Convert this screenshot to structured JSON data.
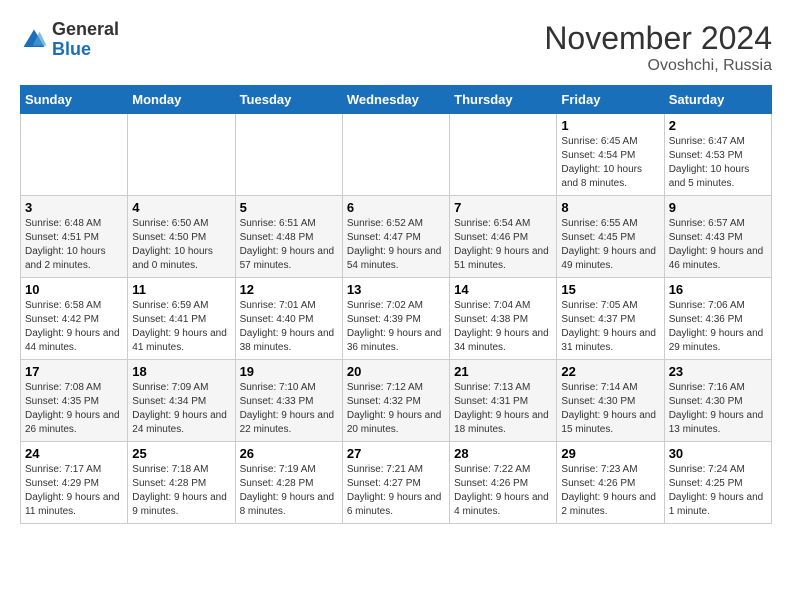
{
  "logo": {
    "general": "General",
    "blue": "Blue"
  },
  "header": {
    "month": "November 2024",
    "location": "Ovoshchi, Russia"
  },
  "days_of_week": [
    "Sunday",
    "Monday",
    "Tuesday",
    "Wednesday",
    "Thursday",
    "Friday",
    "Saturday"
  ],
  "weeks": [
    [
      {
        "day": "",
        "info": ""
      },
      {
        "day": "",
        "info": ""
      },
      {
        "day": "",
        "info": ""
      },
      {
        "day": "",
        "info": ""
      },
      {
        "day": "",
        "info": ""
      },
      {
        "day": "1",
        "info": "Sunrise: 6:45 AM\nSunset: 4:54 PM\nDaylight: 10 hours and 8 minutes."
      },
      {
        "day": "2",
        "info": "Sunrise: 6:47 AM\nSunset: 4:53 PM\nDaylight: 10 hours and 5 minutes."
      }
    ],
    [
      {
        "day": "3",
        "info": "Sunrise: 6:48 AM\nSunset: 4:51 PM\nDaylight: 10 hours and 2 minutes."
      },
      {
        "day": "4",
        "info": "Sunrise: 6:50 AM\nSunset: 4:50 PM\nDaylight: 10 hours and 0 minutes."
      },
      {
        "day": "5",
        "info": "Sunrise: 6:51 AM\nSunset: 4:48 PM\nDaylight: 9 hours and 57 minutes."
      },
      {
        "day": "6",
        "info": "Sunrise: 6:52 AM\nSunset: 4:47 PM\nDaylight: 9 hours and 54 minutes."
      },
      {
        "day": "7",
        "info": "Sunrise: 6:54 AM\nSunset: 4:46 PM\nDaylight: 9 hours and 51 minutes."
      },
      {
        "day": "8",
        "info": "Sunrise: 6:55 AM\nSunset: 4:45 PM\nDaylight: 9 hours and 49 minutes."
      },
      {
        "day": "9",
        "info": "Sunrise: 6:57 AM\nSunset: 4:43 PM\nDaylight: 9 hours and 46 minutes."
      }
    ],
    [
      {
        "day": "10",
        "info": "Sunrise: 6:58 AM\nSunset: 4:42 PM\nDaylight: 9 hours and 44 minutes."
      },
      {
        "day": "11",
        "info": "Sunrise: 6:59 AM\nSunset: 4:41 PM\nDaylight: 9 hours and 41 minutes."
      },
      {
        "day": "12",
        "info": "Sunrise: 7:01 AM\nSunset: 4:40 PM\nDaylight: 9 hours and 38 minutes."
      },
      {
        "day": "13",
        "info": "Sunrise: 7:02 AM\nSunset: 4:39 PM\nDaylight: 9 hours and 36 minutes."
      },
      {
        "day": "14",
        "info": "Sunrise: 7:04 AM\nSunset: 4:38 PM\nDaylight: 9 hours and 34 minutes."
      },
      {
        "day": "15",
        "info": "Sunrise: 7:05 AM\nSunset: 4:37 PM\nDaylight: 9 hours and 31 minutes."
      },
      {
        "day": "16",
        "info": "Sunrise: 7:06 AM\nSunset: 4:36 PM\nDaylight: 9 hours and 29 minutes."
      }
    ],
    [
      {
        "day": "17",
        "info": "Sunrise: 7:08 AM\nSunset: 4:35 PM\nDaylight: 9 hours and 26 minutes."
      },
      {
        "day": "18",
        "info": "Sunrise: 7:09 AM\nSunset: 4:34 PM\nDaylight: 9 hours and 24 minutes."
      },
      {
        "day": "19",
        "info": "Sunrise: 7:10 AM\nSunset: 4:33 PM\nDaylight: 9 hours and 22 minutes."
      },
      {
        "day": "20",
        "info": "Sunrise: 7:12 AM\nSunset: 4:32 PM\nDaylight: 9 hours and 20 minutes."
      },
      {
        "day": "21",
        "info": "Sunrise: 7:13 AM\nSunset: 4:31 PM\nDaylight: 9 hours and 18 minutes."
      },
      {
        "day": "22",
        "info": "Sunrise: 7:14 AM\nSunset: 4:30 PM\nDaylight: 9 hours and 15 minutes."
      },
      {
        "day": "23",
        "info": "Sunrise: 7:16 AM\nSunset: 4:30 PM\nDaylight: 9 hours and 13 minutes."
      }
    ],
    [
      {
        "day": "24",
        "info": "Sunrise: 7:17 AM\nSunset: 4:29 PM\nDaylight: 9 hours and 11 minutes."
      },
      {
        "day": "25",
        "info": "Sunrise: 7:18 AM\nSunset: 4:28 PM\nDaylight: 9 hours and 9 minutes."
      },
      {
        "day": "26",
        "info": "Sunrise: 7:19 AM\nSunset: 4:28 PM\nDaylight: 9 hours and 8 minutes."
      },
      {
        "day": "27",
        "info": "Sunrise: 7:21 AM\nSunset: 4:27 PM\nDaylight: 9 hours and 6 minutes."
      },
      {
        "day": "28",
        "info": "Sunrise: 7:22 AM\nSunset: 4:26 PM\nDaylight: 9 hours and 4 minutes."
      },
      {
        "day": "29",
        "info": "Sunrise: 7:23 AM\nSunset: 4:26 PM\nDaylight: 9 hours and 2 minutes."
      },
      {
        "day": "30",
        "info": "Sunrise: 7:24 AM\nSunset: 4:25 PM\nDaylight: 9 hours and 1 minute."
      }
    ]
  ]
}
